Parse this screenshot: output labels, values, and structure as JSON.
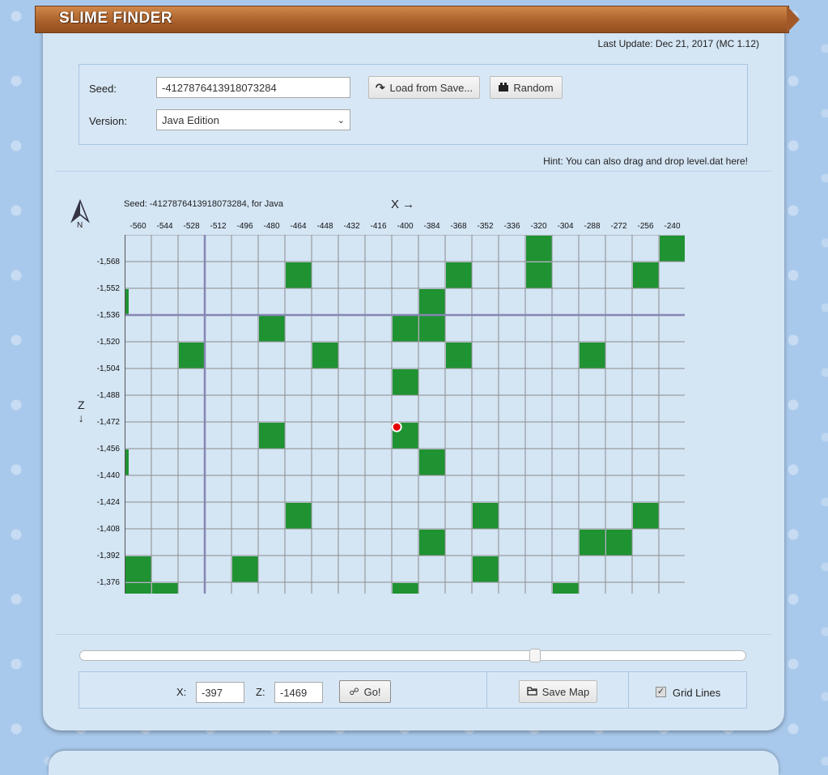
{
  "header": {
    "title": "SLIME FINDER",
    "last_update": "Last Update: Dec 21, 2017 (MC 1.12)"
  },
  "seed_form": {
    "seed_label": "Seed:",
    "seed_value": "-4127876413918073284",
    "version_label": "Version:",
    "version_selected": "Java Edition",
    "load_button": "Load from Save...",
    "random_button": "Random"
  },
  "hint": "Hint: You can also drag and drop level.dat here!",
  "map": {
    "caption": "Seed: -4127876413918073284, for Java",
    "x_axis_label": "X →",
    "z_axis_label": "Z",
    "z_arrow": "↓",
    "compass_letter": "N",
    "x_ticks": [
      "-560",
      "-544",
      "-528",
      "-512",
      "-496",
      "-480",
      "-464",
      "-448",
      "-432",
      "-416",
      "-400",
      "-384",
      "-368",
      "-352",
      "-336",
      "-320",
      "-304",
      "-288",
      "-272",
      "-256",
      "-240"
    ],
    "z_ticks": [
      "-1,568",
      "-1,552",
      "-1,536",
      "-1,520",
      "-1,504",
      "-1,488",
      "-1,472",
      "-1,456",
      "-1,440",
      "-1,424",
      "-1,408",
      "-1,392",
      "-1,376"
    ],
    "marker": {
      "x": -397,
      "z": -1469
    },
    "slime_chunks": [
      [
        -320,
        -1584
      ],
      [
        -240,
        -1584
      ],
      [
        -464,
        -1568
      ],
      [
        -368,
        -1568
      ],
      [
        -320,
        -1568
      ],
      [
        -256,
        -1568
      ],
      [
        -384,
        -1552
      ],
      [
        -480,
        -1536
      ],
      [
        -400,
        -1536
      ],
      [
        -384,
        -1536
      ],
      [
        -528,
        -1520
      ],
      [
        -448,
        -1520
      ],
      [
        -368,
        -1520
      ],
      [
        -288,
        -1520
      ],
      [
        -400,
        -1504
      ],
      [
        -480,
        -1472
      ],
      [
        -400,
        -1472
      ],
      [
        -384,
        -1456
      ],
      [
        -464,
        -1424
      ],
      [
        -352,
        -1424
      ],
      [
        -256,
        -1424
      ],
      [
        -384,
        -1408
      ],
      [
        -288,
        -1408
      ],
      [
        -272,
        -1408
      ],
      [
        -560,
        -1392
      ],
      [
        -496,
        -1392
      ],
      [
        -352,
        -1392
      ],
      [
        -560,
        -1376
      ],
      [
        -544,
        -1376
      ],
      [
        -400,
        -1376
      ],
      [
        -304,
        -1376
      ]
    ],
    "edge_chunks_z": [
      -1552,
      -1456
    ],
    "colors": {
      "slime": "#1f9232",
      "grid": "#8d8d8d",
      "axis": "#8586b2",
      "marker": "#e60000"
    }
  },
  "controls": {
    "slider_value": 0.69,
    "x_label": "X:",
    "x_value": "-397",
    "z_label": "Z:",
    "z_value": "-1469",
    "go_button": "Go!",
    "save_map_button": "Save Map",
    "grid_lines_label": "Grid Lines",
    "grid_lines_checked": true
  }
}
